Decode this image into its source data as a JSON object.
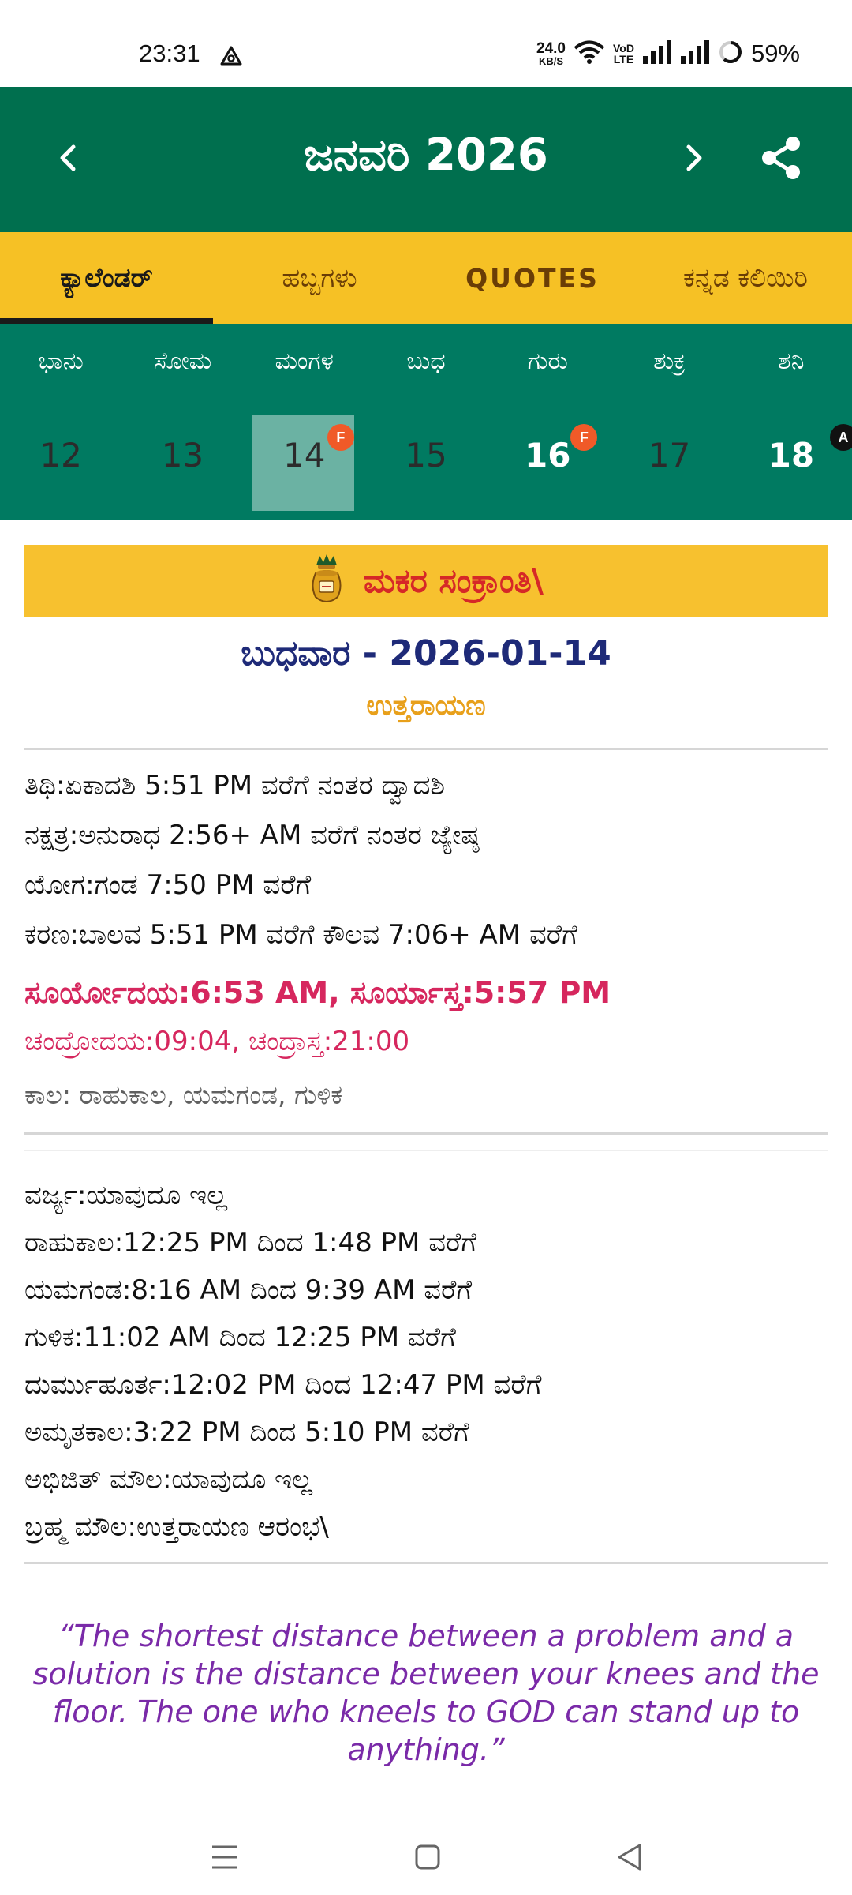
{
  "status_bar": {
    "time": "23:31",
    "net_speed_value": "24.0",
    "net_speed_unit": "KB/S",
    "volte": "VoLTE",
    "battery_percent": "59%"
  },
  "header": {
    "title": "ಜನವರಿ 2026"
  },
  "tabs": [
    {
      "label": "ಕ್ಯಾಲೆಂಡರ್",
      "active": true
    },
    {
      "label": "ಹಬ್ಬಗಳು",
      "active": false
    },
    {
      "label": "QUOTES",
      "active": false
    },
    {
      "label": "ಕನ್ನಡ ಕಲಿಯಿರಿ",
      "active": false
    }
  ],
  "week": {
    "weekdays": [
      "ಭಾನು",
      "ಸೋಮ",
      "ಮಂಗಳ",
      "ಬುಧ",
      "ಗುರು",
      "ಶುಕ್ರ",
      "ಶನಿ"
    ],
    "dates": [
      {
        "day": "12",
        "badge": ""
      },
      {
        "day": "13",
        "badge": ""
      },
      {
        "day": "14",
        "badge": "F",
        "selected": true
      },
      {
        "day": "15",
        "badge": ""
      },
      {
        "day": "16",
        "badge": "F"
      },
      {
        "day": "17",
        "badge": ""
      },
      {
        "day": "18",
        "badge": "A"
      }
    ]
  },
  "festival": {
    "name": "ಮಕರ ಸಂಕ್ರಾಂತಿ\\"
  },
  "day": {
    "title": "ಬುಧವಾರ - 2026-01-14",
    "ayana": "ಉತ್ತರಾಯಣ"
  },
  "panchanga": {
    "tithi": "ತಿಥಿ:ಏಕಾದಶಿ 5:51 PM ವರೆಗೆ ನಂತರ ದ್ವಾದಶಿ",
    "nakshatra": "ನಕ್ಷತ್ರ:ಅನುರಾಧ 2:56+ AM ವರೆಗೆ ನಂತರ ಜ್ಯೇಷ್ಠ",
    "yoga": "ಯೋಗ:ಗಂಡ 7:50 PM ವರೆಗೆ",
    "karana": "ಕರಣ:ಬಾಲವ 5:51 PM ವರೆಗೆ ಕೌಲವ 7:06+ AM ವರೆಗೆ",
    "sun": "ಸೂರ್ಯೋದಯ:6:53 AM, ಸೂರ್ಯಾಸ್ತ:5:57 PM",
    "moon": "ಚಂದ್ರೋದಯ:09:04, ಚಂದ್ರಾಸ್ತ:21:00",
    "kala": "ಕಾಲ: ರಾಹುಕಾಲ, ಯಮಗಂಡ, ಗುಳಿಕ"
  },
  "timings": {
    "varjya": "ವರ್ಜ್ಯ:ಯಾವುದೂ ಇಲ್ಲ",
    "rahukala": "ರಾಹುಕಾಲ:12:25 PM ದಿಂದ 1:48 PM ವರೆಗೆ",
    "yamaganda": "ಯಮಗಂಡ:8:16 AM ದಿಂದ 9:39 AM ವರೆಗೆ",
    "gulika": "ಗುಳಿಕ:11:02 AM ದಿಂದ 12:25 PM ವರೆಗೆ",
    "durmuhurta": "ದುರ್ಮುಹೂರ್ತ:12:02 PM ದಿಂದ 12:47 PM ವರೆಗೆ",
    "amrutakala": "ಅಮೃತಕಾಲ:3:22 PM ದಿಂದ  5:10 PM ವರೆಗೆ",
    "abhijit": "ಅಭಿಜಿತ್ ಮೌಲ:ಯಾವುದೂ ಇಲ್ಲ",
    "brahma": "ಬ್ರಹ್ಮ ಮೌಲ:ಉತ್ತರಾಯಣ ಆರಂಭ\\"
  },
  "quote": {
    "text": "“The shortest distance between a problem and a solution is the distance between your knees and the floor. The one who kneels to GOD can stand up to anything.”"
  },
  "colors": {
    "header_green": "#006f4e",
    "week_green": "#007a61",
    "tab_yellow": "#f6c125",
    "festival_red": "#d62827",
    "sun_pink": "#d6275e",
    "quote_purple": "#7a2aa8"
  }
}
